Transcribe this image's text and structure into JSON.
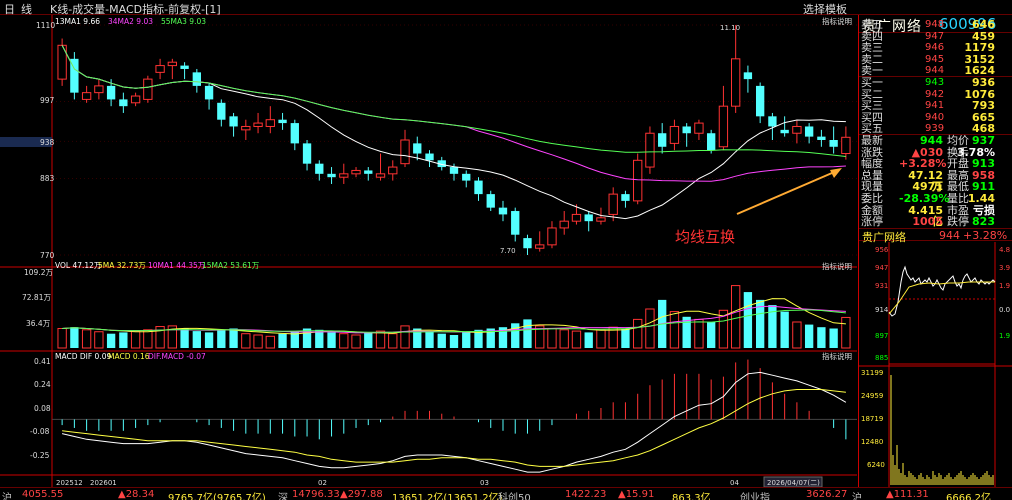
{
  "topbar": {
    "period": "日线",
    "title": "K线-成交量-MACD指标-前复权-[1]",
    "template_label": "选择模板"
  },
  "kline": {
    "legend": [
      {
        "text": "13MA1 9.66",
        "color": "#ffffff"
      },
      {
        "text": "34MA2 9.03",
        "color": "#ff44ff"
      },
      {
        "text": "55MA3 9.03",
        "color": "#55ff55"
      }
    ],
    "ind_label": "指标说明",
    "y_ticks": [
      "1110",
      "997",
      "938",
      "883",
      "770"
    ],
    "hi_label": "11.10",
    "lo_label": "7.70",
    "annotation": "均线互换"
  },
  "volume": {
    "legend": [
      {
        "text": "VOL 47.12万",
        "color": "#ffffff"
      },
      {
        "text": "5MA 32.73万",
        "color": "#ffff44"
      },
      {
        "text": "10MA1 44.35万",
        "color": "#ff44ff"
      },
      {
        "text": "15MA2 53.61万",
        "color": "#55ff55"
      }
    ],
    "ind_label": "指标说明",
    "y_ticks": [
      "109.2万",
      "72.81万",
      "36.4万"
    ]
  },
  "macd": {
    "legend": [
      {
        "text": "MACD DIF 0.09",
        "color": "#ffffff"
      },
      {
        "text": "MACD 0.16",
        "color": "#ffff44"
      },
      {
        "text": "DIF.MACD -0.07",
        "color": "#ff44ff"
      }
    ],
    "ind_label": "指标说明",
    "y_ticks": [
      "0.41",
      "0.24",
      "0.08",
      "-0.08",
      "-0.25"
    ]
  },
  "xaxis": {
    "labels": [
      "202512",
      "202601",
      "02",
      "03",
      "04"
    ],
    "date_box": "2026/04/07(二)"
  },
  "side": {
    "name": "贵广网络",
    "code": "600996",
    "sell": [
      {
        "label": "卖五",
        "price": "948",
        "vol": "646"
      },
      {
        "label": "卖四",
        "price": "947",
        "vol": "459"
      },
      {
        "label": "卖三",
        "price": "946",
        "vol": "1179"
      },
      {
        "label": "卖二",
        "price": "945",
        "vol": "3152"
      },
      {
        "label": "卖一",
        "price": "944",
        "vol": "1624"
      }
    ],
    "buy": [
      {
        "label": "买一",
        "price": "943",
        "vol": "936"
      },
      {
        "label": "买二",
        "price": "942",
        "vol": "1076"
      },
      {
        "label": "买三",
        "price": "941",
        "vol": "793"
      },
      {
        "label": "买四",
        "price": "940",
        "vol": "665"
      },
      {
        "label": "买五",
        "price": "939",
        "vol": "468"
      }
    ],
    "quote": [
      {
        "l1": "最新",
        "v1": "944",
        "c1": "#00ff00",
        "l2": "均价",
        "v2": "937",
        "c2": "#00ff00"
      },
      {
        "l1": "涨跌",
        "v1": "▲030",
        "c1": "#ff4444",
        "l2": "换手",
        "v2": "3.78%",
        "c2": "#ffffff"
      },
      {
        "l1": "幅度",
        "v1": "+3.28%",
        "c1": "#ff4444",
        "l2": "开盘",
        "v2": "913",
        "c2": "#00ff00"
      },
      {
        "l1": "总量",
        "v1": "47.12万",
        "c1": "#ffeb3b",
        "l2": "最高",
        "v2": "958",
        "c2": "#ff4444"
      },
      {
        "l1": "现量",
        "v1": "4971",
        "c1": "#ffeb3b",
        "l2": "最低",
        "v2": "911",
        "c2": "#00ff00"
      },
      {
        "l1": "委比",
        "v1": "-28.39%",
        "c1": "#00ff00",
        "l2": "量比",
        "v2": "1.44",
        "c2": "#ffeb3b"
      },
      {
        "l1": "金额",
        "v1": "4.415亿",
        "c1": "#ffeb3b",
        "l2": "市盈",
        "v2": "亏损",
        "c2": "#ffffff"
      },
      {
        "l1": "涨停",
        "v1": "1005",
        "c1": "#ff4444",
        "l2": "跌停",
        "v2": "823",
        "c2": "#00ff00"
      }
    ],
    "mini_name": "贵广网络",
    "mini_price": "944",
    "mini_change": "+3.28%",
    "mini_price_ticks": [
      "956",
      "947",
      "931",
      "914",
      "897",
      "885"
    ],
    "mini_pct_ticks": [
      "4.8",
      "3.9",
      "1.9",
      "0.0",
      "1.9"
    ],
    "mini_vol_ticks": [
      "31199",
      "24959",
      "18719",
      "12480",
      "6240"
    ]
  },
  "statusbar": [
    {
      "text": "沪",
      "color": "#c0c0c0"
    },
    {
      "text": "4055.55",
      "color": "#ff4444"
    },
    {
      "text": "▲28.34",
      "color": "#ff4444"
    },
    {
      "text": "9765.7亿(9765.7亿)",
      "color": "#ffeb3b"
    },
    {
      "text": "深",
      "color": "#c0c0c0"
    },
    {
      "text": "14796.33",
      "color": "#ff4444"
    },
    {
      "text": "▲297.88",
      "color": "#ff4444"
    },
    {
      "text": "13651.2亿(13651.2亿)",
      "color": "#ffeb3b"
    },
    {
      "text": "科创50",
      "color": "#c0c0c0"
    },
    {
      "text": "1422.23",
      "color": "#ff4444"
    },
    {
      "text": "▲15.91",
      "color": "#ff4444"
    },
    {
      "text": "863.3亿",
      "color": "#ffeb3b"
    },
    {
      "text": "创业指",
      "color": "#c0c0c0"
    },
    {
      "text": "3626.27",
      "color": "#ff4444"
    },
    {
      "text": "沪",
      "color": "#c0c0c0"
    },
    {
      "text": "▲111.31",
      "color": "#ff4444"
    },
    {
      "text": "6666.2亿",
      "color": "#ffeb3b"
    }
  ],
  "chart_data": {
    "type": "candlestick",
    "price_range": [
      7.7,
      11.1
    ],
    "candles": [
      [
        10.3,
        10.8,
        10.9,
        10.2
      ],
      [
        10.6,
        10.1,
        10.7,
        10.0
      ],
      [
        10.0,
        10.1,
        10.2,
        9.95
      ],
      [
        10.1,
        10.2,
        10.3,
        10.0
      ],
      [
        10.2,
        10.0,
        10.3,
        9.9
      ],
      [
        10.0,
        9.9,
        10.1,
        9.8
      ],
      [
        9.95,
        10.05,
        10.1,
        9.9
      ],
      [
        10.0,
        10.3,
        10.35,
        9.95
      ],
      [
        10.4,
        10.5,
        10.6,
        10.3
      ],
      [
        10.5,
        10.55,
        10.6,
        10.3
      ],
      [
        10.5,
        10.45,
        10.55,
        10.3
      ],
      [
        10.4,
        10.2,
        10.45,
        10.1
      ],
      [
        10.2,
        10.0,
        10.25,
        9.85
      ],
      [
        9.95,
        9.7,
        10.0,
        9.6
      ],
      [
        9.75,
        9.6,
        9.8,
        9.45
      ],
      [
        9.55,
        9.6,
        9.7,
        9.4
      ],
      [
        9.6,
        9.65,
        9.8,
        9.5
      ],
      [
        9.6,
        9.7,
        9.9,
        9.5
      ],
      [
        9.7,
        9.65,
        9.8,
        9.55
      ],
      [
        9.65,
        9.35,
        9.7,
        9.25
      ],
      [
        9.35,
        9.05,
        9.4,
        8.95
      ],
      [
        9.05,
        8.9,
        9.1,
        8.8
      ],
      [
        8.9,
        8.85,
        9.0,
        8.75
      ],
      [
        8.85,
        8.9,
        9.05,
        8.75
      ],
      [
        8.9,
        8.95,
        9.0,
        8.85
      ],
      [
        8.95,
        8.9,
        9.0,
        8.8
      ],
      [
        8.85,
        8.9,
        9.2,
        8.8
      ],
      [
        8.9,
        9.0,
        9.1,
        8.8
      ],
      [
        9.05,
        9.4,
        9.55,
        9.0
      ],
      [
        9.35,
        9.2,
        9.45,
        9.1
      ],
      [
        9.2,
        9.1,
        9.25,
        9.0
      ],
      [
        9.1,
        9.0,
        9.15,
        8.95
      ],
      [
        9.0,
        8.9,
        9.05,
        8.8
      ],
      [
        8.9,
        8.8,
        8.95,
        8.7
      ],
      [
        8.8,
        8.6,
        8.85,
        8.5
      ],
      [
        8.6,
        8.4,
        8.65,
        8.35
      ],
      [
        8.4,
        8.3,
        8.5,
        8.2
      ],
      [
        8.35,
        8.0,
        8.4,
        7.9
      ],
      [
        7.95,
        7.8,
        8.0,
        7.7
      ],
      [
        7.8,
        7.85,
        8.05,
        7.75
      ],
      [
        7.85,
        8.1,
        8.2,
        7.8
      ],
      [
        8.1,
        8.2,
        8.35,
        8.0
      ],
      [
        8.2,
        8.3,
        8.45,
        8.15
      ],
      [
        8.3,
        8.2,
        8.35,
        8.05
      ],
      [
        8.2,
        8.25,
        8.4,
        8.15
      ],
      [
        8.3,
        8.6,
        8.7,
        8.2
      ],
      [
        8.6,
        8.5,
        8.65,
        8.4
      ],
      [
        8.5,
        9.1,
        9.2,
        8.45
      ],
      [
        9.0,
        9.5,
        9.6,
        8.9
      ],
      [
        9.5,
        9.3,
        9.65,
        9.2
      ],
      [
        9.35,
        9.6,
        9.7,
        9.25
      ],
      [
        9.6,
        9.5,
        9.65,
        9.3
      ],
      [
        9.5,
        9.65,
        9.7,
        9.4
      ],
      [
        9.5,
        9.25,
        9.55,
        9.2
      ],
      [
        9.3,
        9.9,
        10.2,
        9.25
      ],
      [
        9.9,
        10.6,
        11.1,
        9.8
      ],
      [
        10.4,
        10.3,
        10.5,
        10.1
      ],
      [
        10.2,
        9.75,
        10.25,
        9.65
      ],
      [
        9.75,
        9.6,
        9.8,
        9.4
      ],
      [
        9.55,
        9.5,
        9.75,
        9.45
      ],
      [
        9.5,
        9.6,
        9.7,
        9.35
      ],
      [
        9.6,
        9.45,
        9.65,
        9.35
      ],
      [
        9.45,
        9.4,
        9.55,
        9.3
      ],
      [
        9.4,
        9.3,
        9.6,
        9.2
      ],
      [
        9.2,
        9.44,
        9.6,
        9.11
      ]
    ],
    "volume": [
      30,
      32,
      28,
      25,
      22,
      24,
      26,
      28,
      33,
      34,
      30,
      26,
      24,
      28,
      30,
      22,
      20,
      18,
      22,
      26,
      30,
      28,
      24,
      22,
      20,
      24,
      26,
      22,
      34,
      30,
      26,
      22,
      20,
      24,
      28,
      30,
      32,
      38,
      44,
      34,
      30,
      28,
      26,
      24,
      28,
      32,
      30,
      44,
      60,
      74,
      56,
      48,
      44,
      40,
      58,
      96,
      86,
      74,
      66,
      56,
      40,
      36,
      32,
      30,
      47
    ],
    "macd_dif": [
      -0.1,
      -0.12,
      -0.14,
      -0.15,
      -0.16,
      -0.17,
      -0.17,
      -0.17,
      -0.16,
      -0.15,
      -0.15,
      -0.16,
      -0.18,
      -0.2,
      -0.22,
      -0.24,
      -0.25,
      -0.26,
      -0.27,
      -0.29,
      -0.31,
      -0.33,
      -0.34,
      -0.34,
      -0.33,
      -0.32,
      -0.31,
      -0.29,
      -0.26,
      -0.25,
      -0.25,
      -0.25,
      -0.26,
      -0.27,
      -0.29,
      -0.31,
      -0.33,
      -0.35,
      -0.37,
      -0.37,
      -0.35,
      -0.33,
      -0.3,
      -0.28,
      -0.26,
      -0.23,
      -0.21,
      -0.16,
      -0.1,
      -0.04,
      0.02,
      0.06,
      0.1,
      0.11,
      0.16,
      0.26,
      0.32,
      0.33,
      0.31,
      0.29,
      0.27,
      0.24,
      0.21,
      0.17,
      0.12
    ],
    "macd_dea": [
      -0.08,
      -0.09,
      -0.1,
      -0.11,
      -0.12,
      -0.13,
      -0.14,
      -0.15,
      -0.15,
      -0.15,
      -0.15,
      -0.15,
      -0.16,
      -0.17,
      -0.18,
      -0.19,
      -0.2,
      -0.21,
      -0.22,
      -0.23,
      -0.25,
      -0.26,
      -0.28,
      -0.29,
      -0.3,
      -0.3,
      -0.3,
      -0.3,
      -0.29,
      -0.28,
      -0.28,
      -0.27,
      -0.27,
      -0.27,
      -0.28,
      -0.28,
      -0.29,
      -0.3,
      -0.32,
      -0.33,
      -0.33,
      -0.33,
      -0.32,
      -0.31,
      -0.3,
      -0.29,
      -0.27,
      -0.25,
      -0.22,
      -0.18,
      -0.14,
      -0.1,
      -0.06,
      -0.03,
      0.01,
      0.06,
      0.11,
      0.15,
      0.18,
      0.2,
      0.21,
      0.21,
      0.21,
      0.2,
      0.19
    ]
  }
}
